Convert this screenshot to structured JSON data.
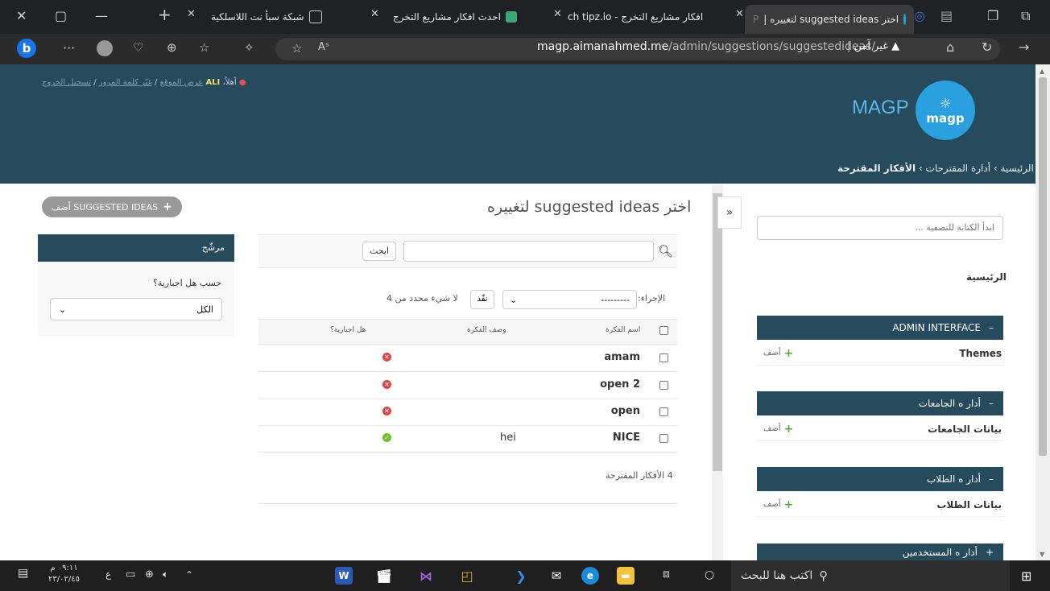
{
  "browser": {
    "tabs": [
      {
        "title": "اختر suggested ideas لتغييره |",
        "trail": "P",
        "active": true
      },
      {
        "title": "افكار مشاريع التخرج - ch tipz.io"
      },
      {
        "title": "احدث افكار مشاريع التخرج"
      },
      {
        "title": "شبكة سبأ نت اللاسلكية"
      }
    ],
    "url_host": "magp.aimanahmed.me",
    "url_path": "/admin/suggestions/suggestedideas/",
    "security_label": "غير آمن",
    "reading_aloud": "Aˢ"
  },
  "header": {
    "user_greeting": "أهلاً،",
    "user_name": "ALI",
    "links": [
      "عرض الموقع",
      "غيّر كلمة المرور",
      "تسجيل الخروج"
    ],
    "logo_text": "MAGP",
    "logo_badge": "magp",
    "breadcrumbs": [
      "الرئيسية",
      "أدارة المقترحات",
      "الأفكار المقترحة"
    ]
  },
  "nav": {
    "toggle": "»",
    "filter_placeholder": "ابدأ الكتابة للتصفية ...",
    "home": "الرئيسية",
    "apps": [
      {
        "caption": "ADMIN INTERFACE",
        "sign": "–",
        "model": "Themes",
        "add": "أضف"
      },
      {
        "caption": "أدار ه الجامعات",
        "sign": "–",
        "model": "بيانات الجامعات",
        "add": "أضف"
      },
      {
        "caption": "أدار ه الطلاب",
        "sign": "–",
        "model": "بيانات الطلاب",
        "add": "أضف"
      },
      {
        "caption": "أدار ه المستخدمين",
        "sign": "+"
      }
    ]
  },
  "content": {
    "title": "اختر suggested ideas لتغييره",
    "add_button": "أضف SUGGESTED IDEAS",
    "search_button": "ابحث",
    "action_label": "الإجراء:",
    "action_value": "---------",
    "go_button": "نفّذ",
    "selection_count": "لا شيء محدد من 4",
    "columns": [
      "اسم الفكرة",
      "وصف الفكرة",
      "هل اجبارية؟"
    ],
    "rows": [
      {
        "name": "amam",
        "description": "",
        "mandatory": false
      },
      {
        "name": "open 2",
        "description": "",
        "mandatory": false
      },
      {
        "name": "open",
        "description": "",
        "mandatory": false
      },
      {
        "name": "NICE",
        "description": "hei",
        "mandatory": true
      }
    ],
    "paginator": "4 الأفكار المقترحة"
  },
  "filter": {
    "header": "مرشّح",
    "title": "حسب هل اجبارية؟",
    "value": "الكل"
  },
  "taskbar": {
    "search_placeholder": "اكتب هنا للبحث",
    "time": "٠٩:١١ م",
    "date": "٢٣/٠٢/٤٥",
    "lang": "ع"
  },
  "colors": {
    "header": "#264b5d",
    "accent": "#2aa0de",
    "add_green": "#5aa72d",
    "false_icon": "#dd4646",
    "true_icon": "#70bf2b"
  }
}
